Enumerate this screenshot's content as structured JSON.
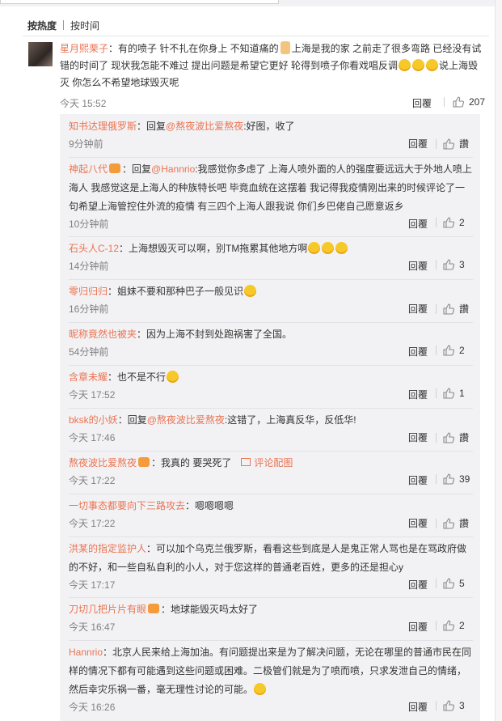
{
  "sort": {
    "hot": "按热度",
    "time": "按时间"
  },
  "main_comment": {
    "user": "星月熙栗子",
    "text_a": "：有的喷子 针不扎在你身上 不知道痛的",
    "text_b": "上海是我的家 之前走了很多弯路 已经没有试错的时间了 现状我怎能不难过 提出问题是希望它更好 轮得到喷子你看戏唱反调",
    "text_c": "说上海毁灭 你怎么不希望地球毁灭呢",
    "time": "今天 15:52",
    "reply_label": "回覆",
    "likes": "207"
  },
  "replies": [
    {
      "user": "知书达理俄罗斯",
      "badge": false,
      "at": "@熬夜波比爱熬夜",
      "prefix": "：回复",
      "text": ":好图，收了",
      "time": "9分钟前",
      "likes": "讚",
      "emojis": 0
    },
    {
      "user": "神起八代",
      "badge": true,
      "at": "@Hannrio",
      "prefix": "：回复",
      "text": ":我感觉你多虑了 上海人喷外面的人的强度要远远大于外地人喷上海人 我感觉这是上海人的种族特长吧 毕竟血统在这摆着 我记得我疫情刚出来的时候评论了一句希望上海管控住外流的疫情 有三四个上海人跟我说 你们乡巴佬自己愿意返乡",
      "time": "10分钟前",
      "likes": "2",
      "emojis": 0
    },
    {
      "user": "石头人C-12",
      "badge": false,
      "at": "",
      "prefix": "：",
      "text": "上海想毁灭可以啊，别TM拖累其他地方啊",
      "time": "14分钟前",
      "likes": "3",
      "emojis": 3
    },
    {
      "user": "零归归归",
      "badge": false,
      "at": "",
      "prefix": "：",
      "text": "姐妹不要和那种巴子一般见识",
      "time": "16分钟前",
      "likes": "讚",
      "emojis": 1
    },
    {
      "user": "昵称竟然也被夹",
      "badge": false,
      "at": "",
      "prefix": "：",
      "text": "因为上海不封到处跑祸害了全国。",
      "time": "54分钟前",
      "likes": "2",
      "emojis": 0
    },
    {
      "user": "含章未耀",
      "badge": false,
      "at": "",
      "prefix": "：",
      "text": "也不是不行",
      "time": "今天 17:52",
      "likes": "1",
      "emojis": 1
    },
    {
      "user": "bksk的小妖",
      "badge": false,
      "at": "@熬夜波比爱熬夜",
      "prefix": "：回复",
      "text": ":这错了，上海真反华，反低华!",
      "time": "今天 17:46",
      "likes": "讚",
      "emojis": 0
    },
    {
      "user": "熬夜波比爱熬夜",
      "badge": true,
      "at": "",
      "prefix": "：",
      "text": "我真的 要哭死了",
      "pic": "评论配图",
      "time": "今天 17:22",
      "likes": "39",
      "emojis": 0
    },
    {
      "user": "一切事态都要向下三路攻去",
      "badge": false,
      "at": "",
      "prefix": "：",
      "text": "嗯嗯嗯嗯",
      "time": "今天 17:22",
      "likes": "讚",
      "emojis": 0
    },
    {
      "user": "洪某的指定监护人",
      "badge": false,
      "at": "",
      "prefix": "：",
      "text": "可以加个乌克兰俄罗斯，看看这些到底是人是鬼正常人骂也是在骂政府做的不好，和一些自私自利的小人，对于您这样的普通老百姓，更多的还是担心y",
      "time": "今天 17:17",
      "likes": "5",
      "emojis": 0
    },
    {
      "user": "刀切几把片片有眼",
      "badge": true,
      "at": "",
      "prefix": "：",
      "text": "地球能毁灭吗太好了",
      "time": "今天 16:47",
      "likes": "2",
      "emojis": 0
    },
    {
      "user": "Hannrio",
      "badge": false,
      "at": "",
      "prefix": "：",
      "text": "北京人民来给上海加油。有问题提出来是为了解决问题，无论在哪里的普通市民在同样的情况下都有可能遇到这些问题或困难。二极管们就是为了喷而喷，只求发泄自己的情绪，然后幸灾乐祸一番，毫无理性讨论的可能。",
      "time": "今天 16:26",
      "likes": "3",
      "emojis": 1
    }
  ],
  "icons": {
    "like": "thumbs-up-icon",
    "picture": "image-icon",
    "badge": "vip-badge-icon",
    "avatar": "user-avatar"
  },
  "colors": {
    "username": "#eb7350",
    "sub_bg": "#f2f2f5",
    "text": "#333333",
    "meta": "#808080"
  }
}
